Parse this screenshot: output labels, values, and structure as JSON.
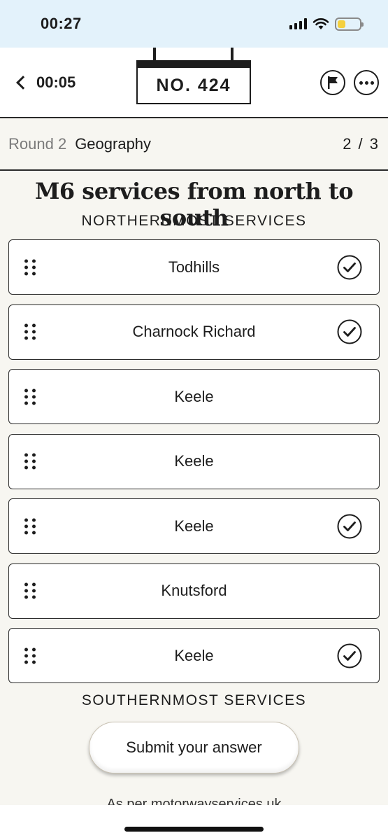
{
  "status_bar": {
    "time": "00:27"
  },
  "header": {
    "timer": "00:05",
    "sign": "NO. 424",
    "icons": [
      "chevron-left-icon",
      "flag-icon",
      "more-icon"
    ]
  },
  "round": {
    "label": "Round 2",
    "topic": "Geography",
    "progress": "2 / 3"
  },
  "question": {
    "title": "M6 services from north to south",
    "top_label": "NORTHERNMOST SERVICES",
    "bottom_label": "SOUTHERNMOST SERVICES"
  },
  "answers": [
    {
      "label": "Todhills",
      "checked": true
    },
    {
      "label": "Charnock Richard",
      "checked": true
    },
    {
      "label": "Keele",
      "checked": false
    },
    {
      "label": "Keele",
      "checked": false
    },
    {
      "label": "Keele",
      "checked": true
    },
    {
      "label": "Knutsford",
      "checked": false
    },
    {
      "label": "Keele",
      "checked": true
    }
  ],
  "submit_label": "Submit your answer",
  "footnote": "As per motorwayservices.uk",
  "colors": {
    "background": "#f7f6f1",
    "status_bar": "#e3f2fb",
    "battery": "#f4d03f",
    "ink": "#1d1d1d"
  }
}
